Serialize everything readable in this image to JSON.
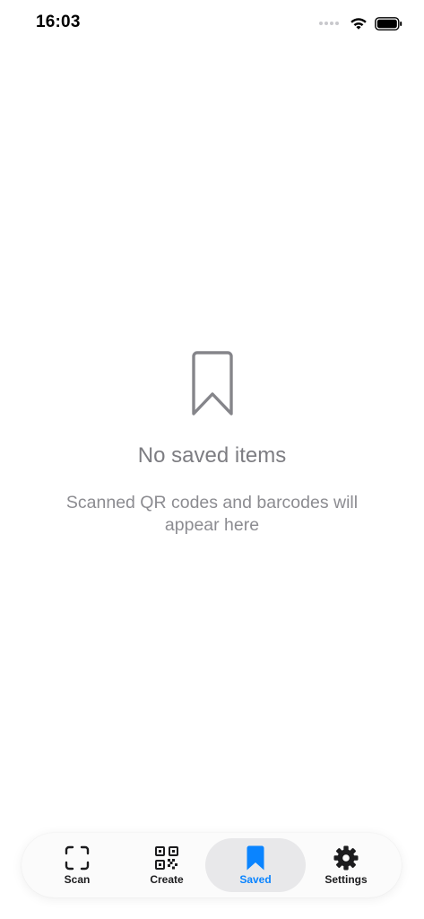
{
  "status_bar": {
    "time": "16:03"
  },
  "empty_state": {
    "title": "No saved items",
    "subtitle": "Scanned QR codes and barcodes will appear here",
    "icon": "bookmark-outline-icon"
  },
  "tab_bar": {
    "active_tab": "saved",
    "accent_color": "#0a84ff",
    "items": [
      {
        "id": "scan",
        "label": "Scan",
        "icon": "scan-frame-icon"
      },
      {
        "id": "create",
        "label": "Create",
        "icon": "qr-code-icon"
      },
      {
        "id": "saved",
        "label": "Saved",
        "icon": "bookmark-filled-icon"
      },
      {
        "id": "settings",
        "label": "Settings",
        "icon": "gear-icon"
      }
    ]
  }
}
